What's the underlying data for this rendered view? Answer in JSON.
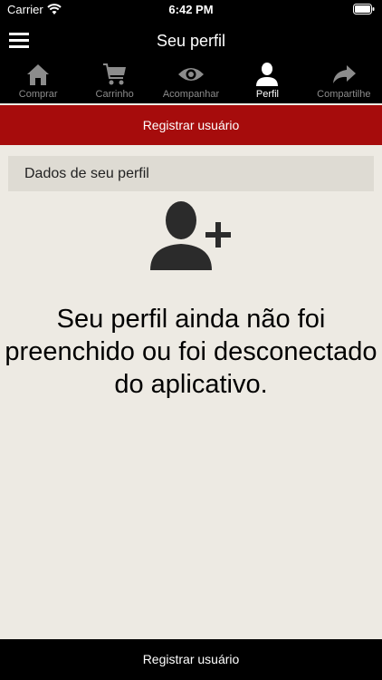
{
  "status_bar": {
    "carrier": "Carrier",
    "time": "6:42 PM",
    "wifi_icon": "wifi-icon",
    "battery_icon": "battery-icon"
  },
  "header": {
    "title": "Seu perfil",
    "menu_icon": "hamburger-menu-icon"
  },
  "tabs": [
    {
      "label": "Comprar",
      "icon": "home-icon",
      "active": false
    },
    {
      "label": "Carrinho",
      "icon": "cart-icon",
      "active": false
    },
    {
      "label": "Acompanhar",
      "icon": "eye-icon",
      "active": false
    },
    {
      "label": "Perfil",
      "icon": "person-icon",
      "active": true
    },
    {
      "label": "Compartilhe",
      "icon": "share-arrow-icon",
      "active": false
    }
  ],
  "banner": {
    "label": "Registrar usuário"
  },
  "section": {
    "header": "Dados de seu perfil",
    "icon": "add-user-icon"
  },
  "main": {
    "message": "Seu perfil ainda não foi preenchido ou foi desconectado do aplicativo."
  },
  "bottom_button": {
    "label": "Registrar usuário"
  },
  "colors": {
    "header_bg": "#000000",
    "banner_bg": "#a60c0c",
    "content_bg": "#edeae3",
    "section_bg": "#dedbd3",
    "tab_inactive": "#8c8c8c",
    "tab_active": "#ffffff"
  }
}
